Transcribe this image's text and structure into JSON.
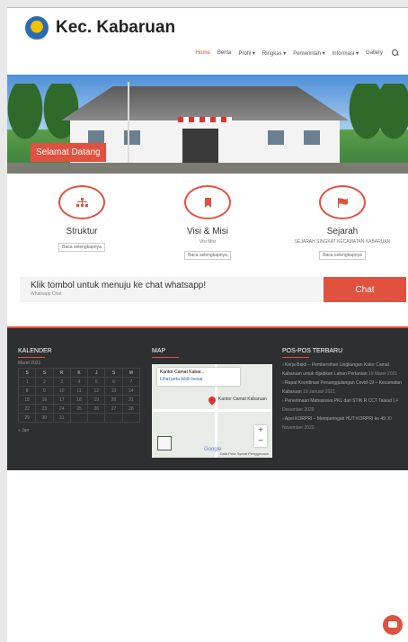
{
  "site": {
    "name": "Kec. Kabaruan"
  },
  "nav": {
    "items": [
      {
        "label": "Home",
        "active": true
      },
      {
        "label": "Berita"
      },
      {
        "label": "Profil ▾"
      },
      {
        "label": "Ringkas ▾"
      },
      {
        "label": "Pemerintah ▾"
      },
      {
        "label": "Informasi ▾"
      },
      {
        "label": "Gallery"
      }
    ],
    "search_icon": "search-icon"
  },
  "hero": {
    "badge": "Selamat Datang"
  },
  "features": [
    {
      "title": "Struktur",
      "subtitle": "",
      "more": "Baca selengkapnya",
      "icon": "org-chart-icon"
    },
    {
      "title": "Visi & Misi",
      "subtitle": "Visi Misi",
      "more": "Baca selengkapnya",
      "icon": "bookmark-icon"
    },
    {
      "title": "Sejarah",
      "subtitle": "SEJARAH SINGKAT KECAMATAN KABARUAN",
      "more": "Baca selengkapnya",
      "icon": "flag-icon"
    }
  ],
  "whatsapp": {
    "text": "Klik tombol untuk menuju ke chat whatsapp!",
    "small": "Whatsapp Chat",
    "button": "Chat"
  },
  "footer": {
    "calendar": {
      "heading": "KALENDER",
      "month": "Maret 2021",
      "days": [
        "S",
        "S",
        "R",
        "K",
        "J",
        "S",
        "M"
      ],
      "weeks": [
        [
          "1",
          "2",
          "3",
          "4",
          "5",
          "6",
          "7"
        ],
        [
          "8",
          "9",
          "10",
          "11",
          "12",
          "13",
          "14"
        ],
        [
          "15",
          "16",
          "17",
          "18",
          "19",
          "20",
          "21"
        ],
        [
          "22",
          "23",
          "24",
          "25",
          "26",
          "27",
          "28"
        ],
        [
          "29",
          "30",
          "31",
          "",
          "",
          "",
          ""
        ]
      ],
      "prev": "« Jan"
    },
    "map": {
      "heading": "MAP",
      "card_title": "Kantor Camat Kabar...",
      "card_link": "Lihat peta lebih besar",
      "pin_label": "Kantor Camat Kabaruan",
      "zoom_in": "+",
      "zoom_out": "−",
      "google": "Google",
      "legal": "Data Peta   Syarat Penggunaan"
    },
    "posts": {
      "heading": "POS-POS TERBARU",
      "items": [
        {
          "text": "› Kerja Bakti – Pembersihan Lingkungan Kator Camat Kabaruan untuk dijadikan Lahan Pertanian",
          "date": "19 Maret 2021"
        },
        {
          "text": "› Rapat Koordinasi Penanggulangan Covid-19 – Kecamatan Kabaruan",
          "date": "19 Januari 2021"
        },
        {
          "text": "› Penerimaan Mahasiswa PKL dari STIK R CCT Talaud",
          "date": "14 Desember 2020"
        },
        {
          "text": "› Apel KORPRI – Memperingati HUT KORPRI ke 49",
          "date": "30 November 2020"
        }
      ]
    }
  },
  "colors": {
    "accent": "#e0513f",
    "footer_bg": "#2e2f31"
  }
}
